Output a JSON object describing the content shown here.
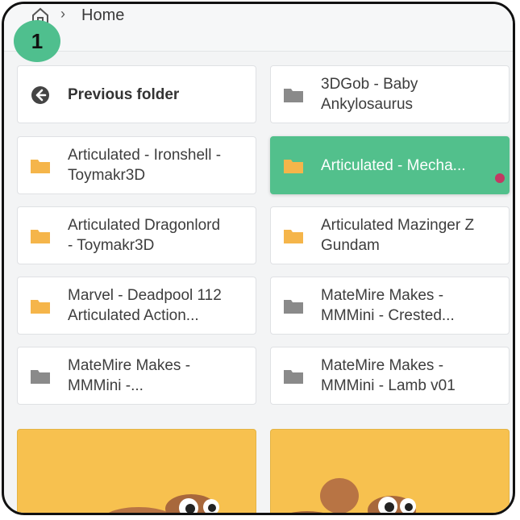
{
  "breadcrumb": {
    "separator": "›",
    "home_label": "Home"
  },
  "step_badge": "1",
  "tiles": [
    {
      "label_line1": "Previous folder",
      "label_line2": "",
      "icon": "back-arrow-icon"
    },
    {
      "label_line1": "3DGob - Baby",
      "label_line2": "Ankylosaurus",
      "icon": "folder-icon-gray"
    },
    {
      "label_line1": "Articulated - Ironshell -",
      "label_line2": "Toymakr3D",
      "icon": "folder-icon-orange"
    },
    {
      "label_line1": "Articulated - Mecha...",
      "label_line2": "",
      "icon": "folder-icon-white"
    },
    {
      "label_line1": "Articulated Dragonlord",
      "label_line2": "- Toymakr3D",
      "icon": "folder-icon-orange"
    },
    {
      "label_line1": "Articulated Mazinger Z",
      "label_line2": "Gundam",
      "icon": "folder-icon-orange"
    },
    {
      "label_line1": "Marvel - Deadpool 112",
      "label_line2": "Articulated Action...",
      "icon": "folder-icon-orange"
    },
    {
      "label_line1": "MateMire Makes -",
      "label_line2": "MMMini - Crested...",
      "icon": "folder-icon-gray"
    },
    {
      "label_line1": "MateMire Makes -",
      "label_line2": "MMMini -...",
      "icon": "folder-icon-gray"
    },
    {
      "label_line1": "MateMire Makes -",
      "label_line2": "MMMini - Lamb v01",
      "icon": "folder-icon-gray"
    }
  ],
  "colors": {
    "accent_green": "#52c08c",
    "folder_orange": "#f5b54a",
    "folder_gray": "#8a8a8a",
    "dot_red": "#c23a63",
    "thumb_bg": "#f7c14f"
  }
}
